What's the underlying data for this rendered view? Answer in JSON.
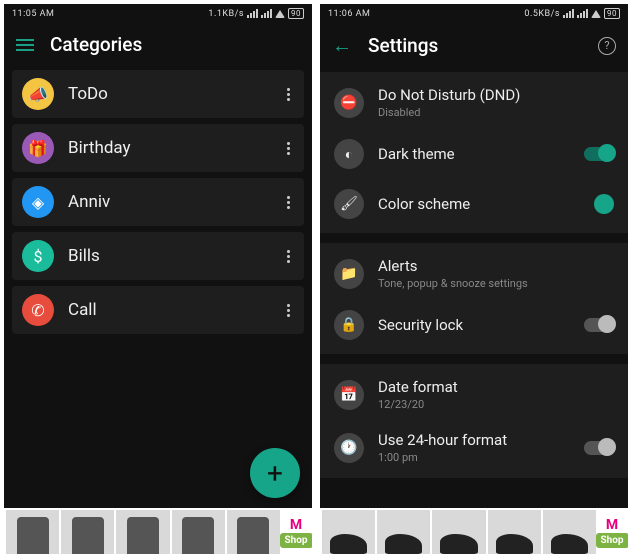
{
  "left": {
    "status": {
      "time": "11:05 AM",
      "net": "1.1KB/s",
      "battery": "90"
    },
    "header": {
      "title": "Categories"
    },
    "categories": [
      {
        "label": "ToDo"
      },
      {
        "label": "Birthday"
      },
      {
        "label": "Anniv"
      },
      {
        "label": "Bills"
      },
      {
        "label": "Call"
      }
    ],
    "fab_glyph": "+",
    "ad": {
      "shop_label": "Shop",
      "brand_glyph": "M"
    }
  },
  "right": {
    "status": {
      "time": "11:06 AM",
      "net": "0.5KB/s",
      "battery": "90"
    },
    "header": {
      "title": "Settings",
      "help": "?"
    },
    "group1": {
      "dnd_title": "Do Not Disturb (DND)",
      "dnd_sub": "Disabled",
      "dark_title": "Dark theme",
      "color_title": "Color scheme"
    },
    "group2": {
      "alerts_title": "Alerts",
      "alerts_sub": "Tone, popup & snooze settings",
      "lock_title": "Security lock"
    },
    "group3": {
      "date_title": "Date format",
      "date_sub": "12/23/20",
      "h24_title": "Use 24-hour format",
      "h24_sub": "1:00 pm"
    },
    "ad": {
      "shop_label": "Shop",
      "brand_glyph": "M"
    }
  }
}
